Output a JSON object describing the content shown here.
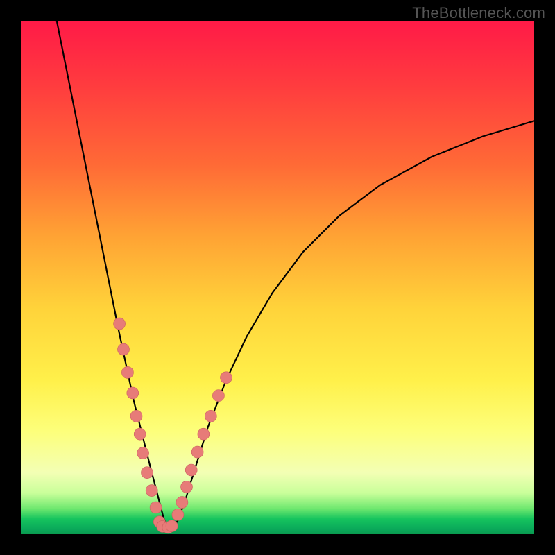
{
  "watermark": "TheBottleneck.com",
  "chart_data": {
    "type": "line",
    "title": "",
    "xlabel": "",
    "ylabel": "",
    "xlim": [
      0,
      100
    ],
    "ylim": [
      0,
      100
    ],
    "grid": false,
    "legend": "none",
    "background": "vertical-spectrum-red-to-green",
    "series": [
      {
        "name": "bottleneck-curve",
        "x": [
          7,
          9,
          11,
          13,
          15,
          17,
          19,
          20.5,
          22,
          23.5,
          25,
          26.3,
          27.2,
          27.8,
          28.5,
          29.3,
          30.5,
          32,
          34,
          36.5,
          40,
          44,
          49,
          55,
          62,
          70,
          80,
          90,
          100
        ],
        "y": [
          100,
          90,
          80,
          70,
          60,
          50,
          40,
          33,
          26,
          20,
          14,
          9,
          5.5,
          3.2,
          1.6,
          1.1,
          2.5,
          6.5,
          13,
          21,
          30,
          38.5,
          47,
          55,
          62,
          68,
          73.5,
          77.5,
          80.5
        ]
      }
    ],
    "dots": {
      "name": "bottleneck-points",
      "x": [
        19.2,
        20.0,
        20.8,
        21.8,
        22.5,
        23.2,
        23.8,
        24.6,
        25.5,
        26.3,
        27.0,
        27.6,
        28.7,
        29.4,
        30.6,
        31.4,
        32.3,
        33.2,
        34.4,
        35.6,
        37.0,
        38.5,
        40.0
      ],
      "y": [
        41.0,
        36.0,
        31.5,
        27.5,
        23.0,
        19.5,
        15.8,
        12.0,
        8.5,
        5.2,
        2.4,
        1.5,
        1.3,
        1.6,
        3.8,
        6.2,
        9.2,
        12.5,
        16.0,
        19.5,
        23.0,
        27.0,
        30.5
      ]
    }
  }
}
